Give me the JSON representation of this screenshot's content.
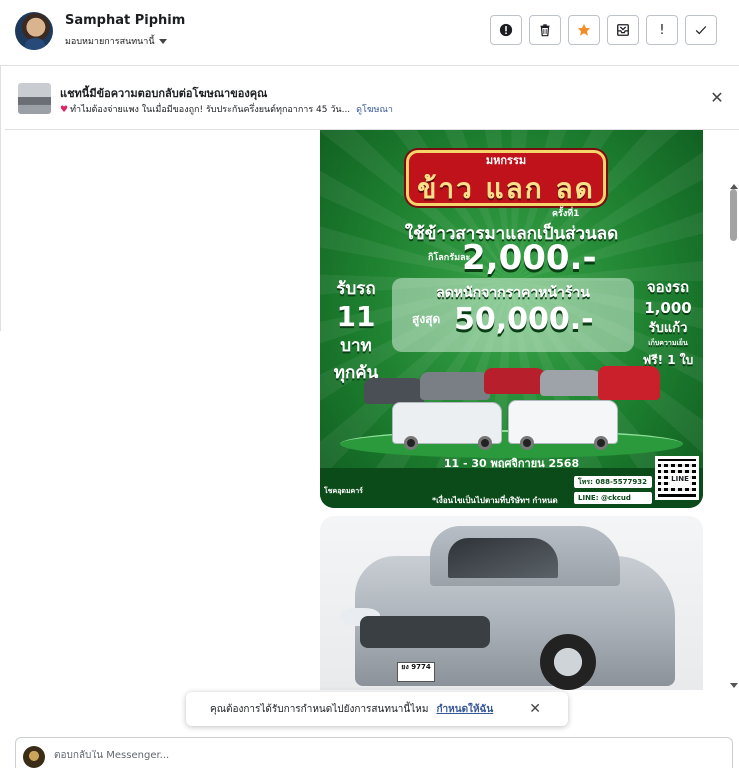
{
  "header": {
    "name": "Samphat Piphim",
    "assign_label": "มอบหมายการสนทนานี้",
    "actions": [
      {
        "name": "spam-report-button",
        "icon": "alert-circle-icon",
        "glyph": "!"
      },
      {
        "name": "delete-button",
        "icon": "trash-icon",
        "glyph": ""
      },
      {
        "name": "star-button",
        "icon": "star-icon",
        "glyph": "★"
      },
      {
        "name": "move-to-inbox-button",
        "icon": "archive-icon",
        "glyph": ""
      },
      {
        "name": "mark-important-button",
        "icon": "exclamation-icon",
        "glyph": "!"
      },
      {
        "name": "mark-done-button",
        "icon": "checkmark-icon",
        "glyph": "✓"
      }
    ]
  },
  "banner": {
    "title": "แชทนี้มีข้อความตอบกลับต่อโฆษณาของคุณ",
    "description": "ทำไมต้องจ่ายแพง ในเมื่อมีของถูก! รับประกันครึ่งยนต์ทุกอาการ 45 วัน...",
    "link": "ดูโฆษณา",
    "heart_icon": "heart-icon"
  },
  "promo": {
    "title_top": "มหกรรม",
    "title": "ข้าว แลก ลด",
    "note": "ครั้งที่1",
    "line1": "ใช้ข้าวสารมาแลกเป็นส่วนลด",
    "per_kg": "กิโลกรัมละ",
    "price1": "2,000.-",
    "left": {
      "a": "รับรถ",
      "b": "11",
      "c": "บาท",
      "d": "ทุกคัน"
    },
    "right": {
      "a": "จองรถ",
      "b": "1,000",
      "c": "รับแก้ว",
      "d": "เก็บความเย็น",
      "e": "ฟรี! 1 ใบ"
    },
    "line2": "ลดหนักจากราคาหน้าร้าน",
    "upto": "สูงสุด",
    "price2": "50,000.-",
    "date": "11 - 30 พฤศจิกายน 2568",
    "footer_logo": "โชคอุดมคาร์",
    "condition": "*เงื่อนไขเป็นไปตามที่บริษัทฯ กำหนด",
    "phone": "โทร: 088-5577932",
    "line_id": "LINE: @ckcud",
    "qr_label": "LINE"
  },
  "photo": {
    "plate": "ยง 9774"
  },
  "toast": {
    "text": "คุณต้องการได้รับการกำหนดไปยังการสนทนานี้ไหม",
    "link": "กำหนดให้ฉัน"
  },
  "composer": {
    "placeholder": "ตอบกลับใน Messenger..."
  }
}
